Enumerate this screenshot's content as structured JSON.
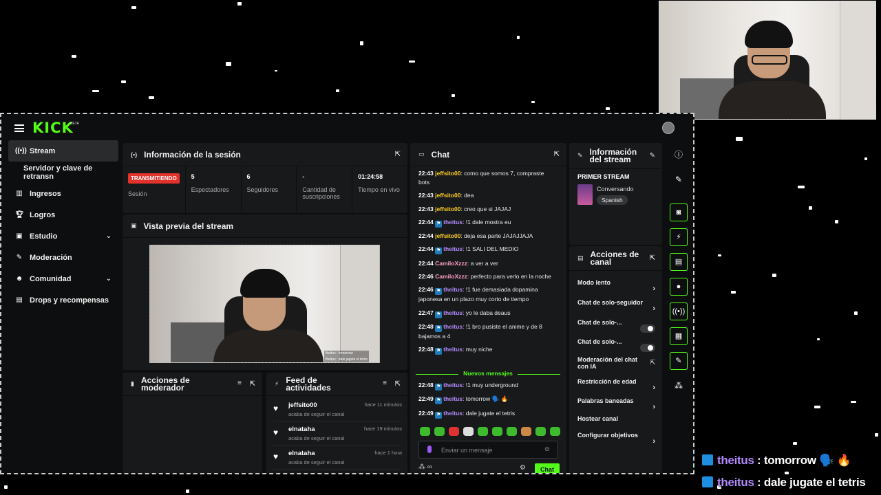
{
  "app": {
    "logo": "KICK",
    "logo_badge": "BETA"
  },
  "sidebar": {
    "items": [
      {
        "label": "Stream",
        "icon": "broadcast-icon"
      },
      {
        "label": "Servidor y clave de retransn",
        "icon": ""
      },
      {
        "label": "Ingresos",
        "icon": "chart-icon"
      },
      {
        "label": "Logros",
        "icon": "trophy-icon"
      },
      {
        "label": "Estudio",
        "icon": "studio-icon"
      },
      {
        "label": "Moderación",
        "icon": "wrench-icon"
      },
      {
        "label": "Comunidad",
        "icon": "community-icon"
      },
      {
        "label": "Drops y recompensas",
        "icon": "gift-icon"
      }
    ]
  },
  "session": {
    "title": "Información de la sesión",
    "status_badge": "TRANSMITIENDO",
    "status_label": "Sesión",
    "viewers_value": "5",
    "viewers_label": "Espectadores",
    "followers_value": "6",
    "followers_label": "Seguidores",
    "subs_value": "-",
    "subs_label": "Cantidad de suscripciones",
    "uptime_value": "01:24:58",
    "uptime_label": "Tiempo en vivo"
  },
  "preview": {
    "title": "Vista previa del stream",
    "overlay_line1": "theitus : tomorrow",
    "overlay_line2": "theitus : dale jugate el tetris"
  },
  "mod_actions": {
    "title": "Acciones de moderador"
  },
  "activity": {
    "title": "Feed de actividades",
    "items": [
      {
        "name": "jeffsito00",
        "action": "acaba de seguir el canal",
        "time": "hace 11 minutos"
      },
      {
        "name": "elnataha",
        "action": "acaba de seguir el canal",
        "time": "hace 19 minutos"
      },
      {
        "name": "elnataha",
        "action": "acaba de seguir el canal",
        "time": "hace 1 hora"
      }
    ]
  },
  "chat": {
    "title": "Chat",
    "messages": [
      {
        "time": "22:43",
        "user": "jeffsito00",
        "badge": false,
        "color": "u1",
        "text": ": como que somos 7, compraste bots"
      },
      {
        "time": "22:43",
        "user": "jeffsito00",
        "badge": false,
        "color": "u1",
        "text": ": dea"
      },
      {
        "time": "22:43",
        "user": "jeffsito00",
        "badge": false,
        "color": "u1",
        "text": ": creo que si JAJAJ"
      },
      {
        "time": "22:44",
        "user": "theitus",
        "badge": true,
        "color": "u2",
        "text": ": !1 dale mostra eu"
      },
      {
        "time": "22:44",
        "user": "jeffsito00",
        "badge": false,
        "color": "u1",
        "text": ": deja esa parte JAJAJJAJA"
      },
      {
        "time": "22:44",
        "user": "theitus",
        "badge": true,
        "color": "u2",
        "text": ": !1 SALI DEL MEDIO"
      },
      {
        "time": "22:44",
        "user": "CamiloXzzz",
        "badge": false,
        "color": "u3",
        "text": ": a ver a ver"
      },
      {
        "time": "22:46",
        "user": "CamiloXzzz",
        "badge": false,
        "color": "u3",
        "text": ": perfecto para verlo en la noche"
      },
      {
        "time": "22:46",
        "user": "theitus",
        "badge": true,
        "color": "u2",
        "text": ": !1 fue demasiada dopamina japonesa en un plazo muy corto de tiempo"
      },
      {
        "time": "22:47",
        "user": "theitus",
        "badge": true,
        "color": "u2",
        "text": ": yo le daba deaus"
      },
      {
        "time": "22:48",
        "user": "theitus",
        "badge": true,
        "color": "u2",
        "text": ": !1 bro pusiste el anime y de 8 bajamos a 4"
      },
      {
        "time": "22:48",
        "user": "theitus",
        "badge": true,
        "color": "u2",
        "text": ": muy niche"
      }
    ],
    "new_label": "Nuevos mensajes",
    "new_messages": [
      {
        "time": "22:48",
        "user": "theitus",
        "badge": true,
        "color": "u2",
        "text": ": !1 muy underground"
      },
      {
        "time": "22:49",
        "user": "theitus",
        "badge": true,
        "color": "u2",
        "text": ": tomorrow 🗣️ 🔥"
      },
      {
        "time": "22:49",
        "user": "theitus",
        "badge": true,
        "color": "u2",
        "text": ": dale jugate el tetris"
      }
    ],
    "input_placeholder": "Enviar un mensaje",
    "send_label": "Chat"
  },
  "stream_info": {
    "title": "Información del stream",
    "stream_title": "PRIMER STREAM",
    "category": "Conversando",
    "language": "Spanish"
  },
  "channel_actions": {
    "title": "Acciones de canal",
    "items": [
      {
        "label": "Modo lento",
        "kind": "chevron"
      },
      {
        "label": "Chat de solo-seguidor",
        "kind": "chevron"
      },
      {
        "label": "Chat de solo-...",
        "kind": "toggle"
      },
      {
        "label": "Chat de solo-...",
        "kind": "toggle"
      },
      {
        "label": "Moderación del chat con IA",
        "kind": "external"
      },
      {
        "label": "Restricción de edad",
        "kind": "chevron"
      },
      {
        "label": "Palabras baneadas",
        "kind": "chevron"
      },
      {
        "label": "Hostear canal",
        "kind": "none"
      },
      {
        "label": "Configurar objetivos",
        "kind": "chevron"
      }
    ]
  },
  "overlay_chat": [
    {
      "user": "theitus",
      "text": " : tomorrow 🗣️ 🔥"
    },
    {
      "user": "theitus",
      "text": " : dale jugate el tetris"
    }
  ],
  "colors": {
    "accent": "#53fc18",
    "live": "#e1322b",
    "panel": "#18191b",
    "bg": "#0d0e0f"
  }
}
